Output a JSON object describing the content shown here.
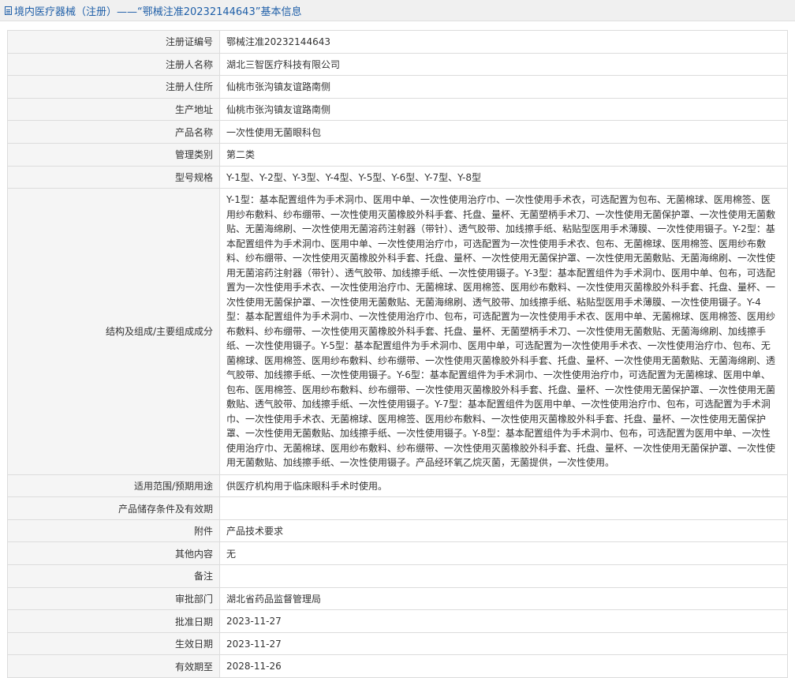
{
  "header": {
    "title": "境内医疗器械（注册）——“鄂械注准20232144643”基本信息"
  },
  "rows": [
    {
      "label": "注册证编号",
      "value": "鄂械注准20232144643"
    },
    {
      "label": "注册人名称",
      "value": "湖北三智医疗科技有限公司"
    },
    {
      "label": "注册人住所",
      "value": "仙桃市张沟镇友谊路南侧"
    },
    {
      "label": "生产地址",
      "value": "仙桃市张沟镇友谊路南侧"
    },
    {
      "label": "产品名称",
      "value": "一次性使用无菌眼科包"
    },
    {
      "label": "管理类别",
      "value": "第二类"
    },
    {
      "label": "型号规格",
      "value": "Y-1型、Y-2型、Y-3型、Y-4型、Y-5型、Y-6型、Y-7型、Y-8型"
    },
    {
      "label": "结构及组成/主要组成成分",
      "value": "Y-1型：基本配置组件为手术洞巾、医用中单、一次性使用治疗巾、一次性使用手术衣，可选配置为包布、无菌棉球、医用棉签、医用纱布敷料、纱布绷带、一次性使用灭菌橡胶外科手套、托盘、量杯、无菌塑柄手术刀、一次性使用无菌保护罩、一次性使用无菌敷贴、无菌海绵刷、一次性使用无菌溶药注射器（带针）、透气胶带、加线擦手纸、粘贴型医用手术薄膜、一次性使用镊子。Y-2型：基本配置组件为手术洞巾、医用中单、一次性使用治疗巾，可选配置为一次性使用手术衣、包布、无菌棉球、医用棉签、医用纱布敷料、纱布绷带、一次性使用灭菌橡胶外科手套、托盘、量杯、一次性使用无菌保护罩、一次性使用无菌敷贴、无菌海绵刷、一次性使用无菌溶药注射器（带针）、透气胶带、加线擦手纸、一次性使用镊子。Y-3型：基本配置组件为手术洞巾、医用中单、包布，可选配置为一次性使用手术衣、一次性使用治疗巾、无菌棉球、医用棉签、医用纱布敷料、一次性使用灭菌橡胶外科手套、托盘、量杯、一次性使用无菌保护罩、一次性使用无菌敷贴、无菌海绵刷、透气胶带、加线擦手纸、粘贴型医用手术薄膜、一次性使用镊子。Y-4型：基本配置组件为手术洞巾、一次性使用治疗巾、包布，可选配置为一次性使用手术衣、医用中单、无菌棉球、医用棉签、医用纱布敷料、纱布绷带、一次性使用灭菌橡胶外科手套、托盘、量杯、无菌塑柄手术刀、一次性使用无菌敷贴、无菌海绵刷、加线擦手纸、一次性使用镊子。Y-5型：基本配置组件为手术洞巾、医用中单，可选配置为一次性使用手术衣、一次性使用治疗巾、包布、无菌棉球、医用棉签、医用纱布敷料、纱布绷带、一次性使用灭菌橡胶外科手套、托盘、量杯、一次性使用无菌敷贴、无菌海绵刷、透气胶带、加线擦手纸、一次性使用镊子。Y-6型：基本配置组件为手术洞巾、一次性使用治疗巾，可选配置为无菌棉球、医用中单、包布、医用棉签、医用纱布敷料、纱布绷带、一次性使用灭菌橡胶外科手套、托盘、量杯、一次性使用无菌保护罩、一次性使用无菌敷贴、透气胶带、加线擦手纸、一次性使用镊子。Y-7型：基本配置组件为医用中单、一次性使用治疗巾、包布，可选配置为手术洞巾、一次性使用手术衣、无菌棉球、医用棉签、医用纱布敷料、一次性使用灭菌橡胶外科手套、托盘、量杯、一次性使用无菌保护罩、一次性使用无菌敷贴、加线擦手纸、一次性使用镊子。Y-8型：基本配置组件为手术洞巾、包布，可选配置为医用中单、一次性使用治疗巾、无菌棉球、医用纱布敷料、纱布绷带、一次性使用灭菌橡胶外科手套、托盘、量杯、一次性使用无菌保护罩、一次性使用无菌敷贴、加线擦手纸、一次性使用镊子。产品经环氧乙烷灭菌，无菌提供，一次性使用。"
    },
    {
      "label": "适用范围/预期用途",
      "value": "供医疗机构用于临床眼科手术时使用。"
    },
    {
      "label": "产品储存条件及有效期",
      "value": ""
    },
    {
      "label": "附件",
      "value": "产品技术要求"
    },
    {
      "label": "其他内容",
      "value": "无"
    },
    {
      "label": "备注",
      "value": ""
    },
    {
      "label": "审批部门",
      "value": "湖北省药品监督管理局"
    },
    {
      "label": "批准日期",
      "value": "2023-11-27"
    },
    {
      "label": "生效日期",
      "value": "2023-11-27"
    },
    {
      "label": "有效期至",
      "value": "2028-11-26"
    }
  ]
}
